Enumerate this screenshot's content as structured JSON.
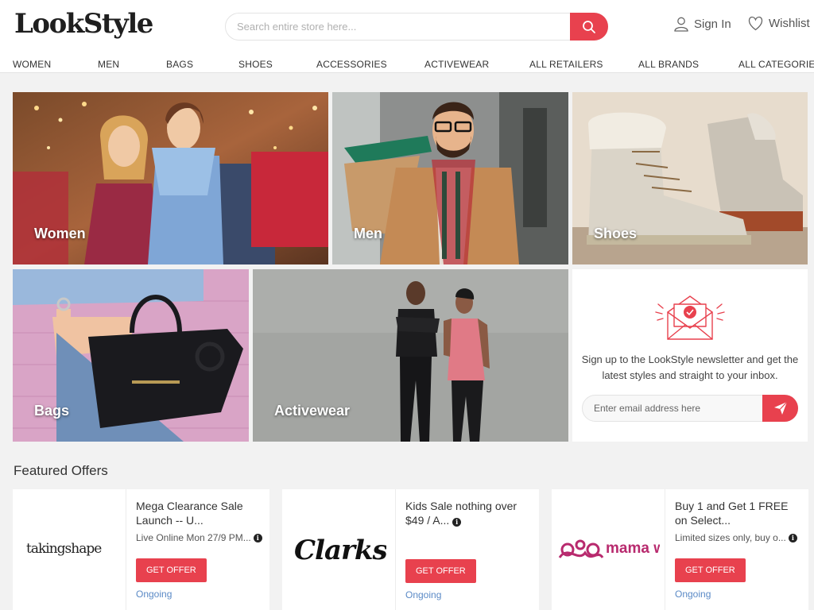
{
  "brand": {
    "logo": "LookStyle"
  },
  "search": {
    "placeholder": "Search entire store here..."
  },
  "account": {
    "signin": "Sign In",
    "wishlist": "Wishlist"
  },
  "nav": [
    "WOMEN",
    "MEN",
    "BAGS",
    "SHOES",
    "ACCESSORIES",
    "ACTIVEWEAR",
    "ALL RETAILERS",
    "ALL BRANDS",
    "ALL CATEGORIES"
  ],
  "tiles": {
    "women": "Women",
    "men": "Men",
    "shoes": "Shoes",
    "bags": "Bags",
    "activewear": "Activewear"
  },
  "newsletter": {
    "text": "Sign up to the LookStyle newsletter and get the latest styles and straight to your inbox.",
    "placeholder": "Enter email address here"
  },
  "featured": {
    "title": "Featured Offers",
    "offers": [
      {
        "logo": "takingshape",
        "title": "Mega Clearance Sale Launch -- U...",
        "subtitle": "Live Online Mon 27/9 PM...",
        "button": "GET OFFER",
        "status": "Ongoing"
      },
      {
        "logo": "Clarks",
        "title": "Kids Sale nothing over $49 / A...",
        "subtitle": "",
        "button": "GET OFFER",
        "status": "Ongoing"
      },
      {
        "logo": "mama way",
        "title": "Buy 1 and Get 1 FREE on Select...",
        "subtitle": "Limited sizes only, buy o...",
        "button": "GET OFFER",
        "status": "Ongoing"
      }
    ]
  },
  "colors": {
    "accent": "#e8414e",
    "status": "#5b8ac6"
  }
}
